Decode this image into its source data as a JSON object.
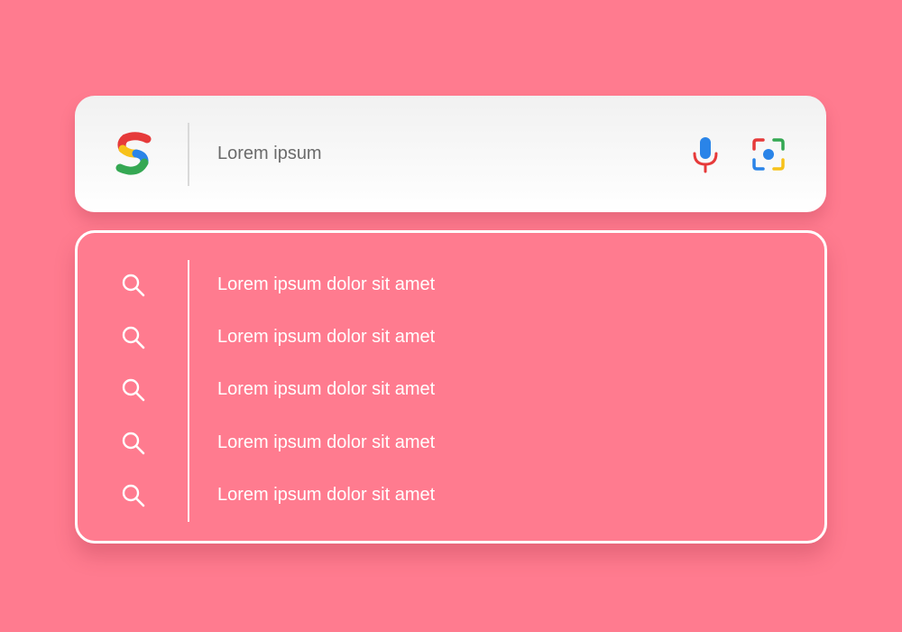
{
  "search": {
    "value": "Lorem ipsum",
    "logo_letter": "S",
    "icons": {
      "logo": "s-logo-icon",
      "mic": "microphone-icon",
      "lens": "camera-lens-icon",
      "suggestion": "search-icon"
    }
  },
  "suggestions": [
    {
      "label": "Lorem ipsum dolor sit amet"
    },
    {
      "label": "Lorem ipsum dolor sit amet"
    },
    {
      "label": "Lorem ipsum dolor sit amet"
    },
    {
      "label": "Lorem ipsum dolor sit amet"
    },
    {
      "label": "Lorem ipsum dolor sit amet"
    }
  ],
  "colors": {
    "background": "#ff7b8f",
    "brand_blue": "#2a84e8",
    "brand_red": "#e63a3a",
    "brand_yellow": "#f7c21a",
    "brand_green": "#35a853",
    "text_gray": "#6b6b6b"
  }
}
